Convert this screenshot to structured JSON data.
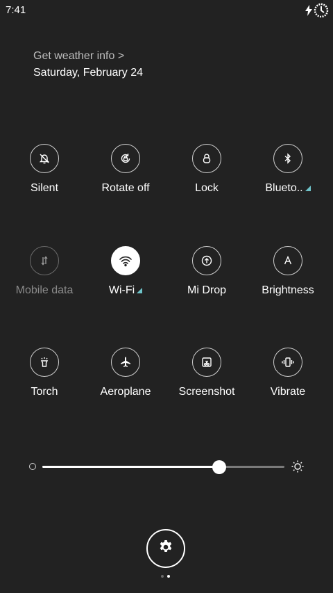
{
  "status_bar": {
    "time": "7:41",
    "icons": [
      "charging-bolt-icon",
      "battery-ring-icon"
    ]
  },
  "weather": {
    "link": "Get weather info >",
    "date": "Saturday, February 24"
  },
  "toggles": [
    {
      "label": "Silent",
      "icon": "bell-off-icon",
      "state": "off"
    },
    {
      "label": "Rotate off",
      "icon": "rotate-lock-icon",
      "state": "off"
    },
    {
      "label": "Lock",
      "icon": "lock-icon",
      "state": "off"
    },
    {
      "label": "Blueto..",
      "icon": "bluetooth-icon",
      "state": "off",
      "has_more": true
    },
    {
      "label": "Mobile data",
      "icon": "data-arrows-icon",
      "state": "disabled"
    },
    {
      "label": "Wi-Fi",
      "icon": "wifi-icon",
      "state": "on",
      "has_more": true
    },
    {
      "label": "Mi Drop",
      "icon": "mi-drop-icon",
      "state": "off"
    },
    {
      "label": "Brightness",
      "icon": "auto-brightness-icon",
      "state": "off"
    },
    {
      "label": "Torch",
      "icon": "torch-icon",
      "state": "off"
    },
    {
      "label": "Aeroplane",
      "icon": "airplane-icon",
      "state": "off"
    },
    {
      "label": "Screenshot",
      "icon": "screenshot-icon",
      "state": "off"
    },
    {
      "label": "Vibrate",
      "icon": "vibrate-icon",
      "state": "off"
    }
  ],
  "brightness": {
    "level": 0.73,
    "low_icon": "brightness-low-icon",
    "high_icon": "brightness-high-icon"
  },
  "settings": {
    "icon": "gear-icon"
  },
  "pager": {
    "count": 2,
    "active": 1
  },
  "colors": {
    "background": "#222222",
    "accent_more": "#6ec3c9",
    "active_tile": "#ffffff",
    "disabled": "#8a8a8a"
  }
}
